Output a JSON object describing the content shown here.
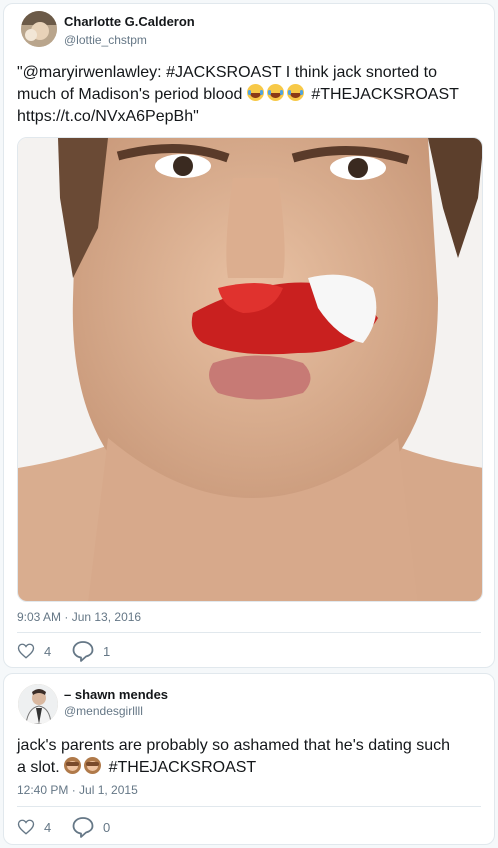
{
  "tweets": [
    {
      "author_name": "Charlotte G.Calderon",
      "author_handle": "@lottie_chstpm",
      "text_line1": "\"@maryirwenlawley: #JACKSROAST I think jack snorted to",
      "text_line2_a": "much of Madison's period blood",
      "text_line2_b": "#THEJACKSROAST",
      "text_line3": "https://t.co/NVxA6PepBh\"",
      "emoji": "tears-of-joy-emoji",
      "timestamp": "9:03 AM · Jun 13, 2016",
      "likes": "4",
      "replies": "1"
    },
    {
      "author_name": "– shawn mendes",
      "author_handle": "@mendesgirllll",
      "text_line1": "jack's parents are probably so ashamed that he's dating such",
      "text_line2_a": "a slot.",
      "text_line2_b": "#THEJACKSROAST",
      "emoji": "speak-no-evil-monkey-emoji",
      "timestamp": "12:40 PM · Jul 1, 2015",
      "likes": "4",
      "replies": "0"
    }
  ],
  "colors": {
    "text": "#14171a",
    "secondary": "#657786",
    "border": "#e1e8ed"
  }
}
